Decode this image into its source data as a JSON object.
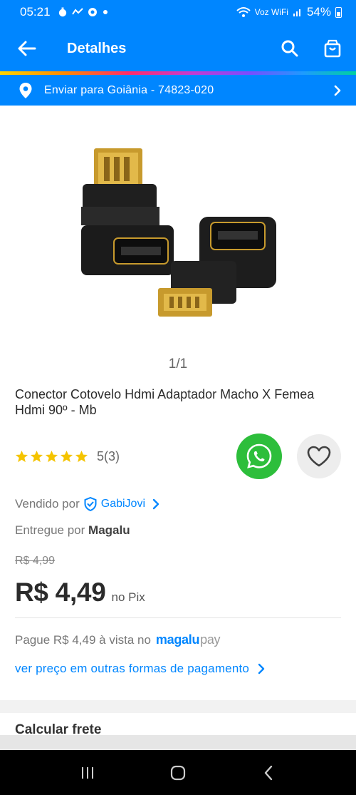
{
  "status": {
    "time": "05:21",
    "left_indicators": [
      "timer-icon",
      "data-icon",
      "chrome-icon",
      "dot"
    ],
    "network_label": "Voz WiFi",
    "battery": "54%"
  },
  "header": {
    "title": "Detalhes",
    "bg_color": "#0086FF"
  },
  "delivery": {
    "text": "Enviar para Goiânia - 74823-020"
  },
  "product": {
    "pager": "1/1",
    "title": "Conector Cotovelo Hdmi Adaptador Macho X Femea Hdmi 90º - Mb",
    "rating": {
      "stars": 5,
      "text": "5(3)"
    },
    "seller": {
      "label": "Vendido por",
      "name": "GabiJovi"
    },
    "delivered_by": {
      "label": "Entregue por",
      "name": "Magalu"
    },
    "old_price": "R$ 4,99",
    "price": "R$ 4,49",
    "price_suffix": "no Pix",
    "pay_text": "Pague R$ 4,49 à vista no",
    "magalu_logo": "magalu",
    "magalu_logo_pay": "pay",
    "other_prices_link": "ver preço em outras formas de pagamento"
  },
  "shipping": {
    "label": "Calcular frete"
  },
  "colors": {
    "brand_blue": "#0086FF",
    "whatsapp_green": "#2DBE3B",
    "star_yellow": "#F5C400"
  }
}
